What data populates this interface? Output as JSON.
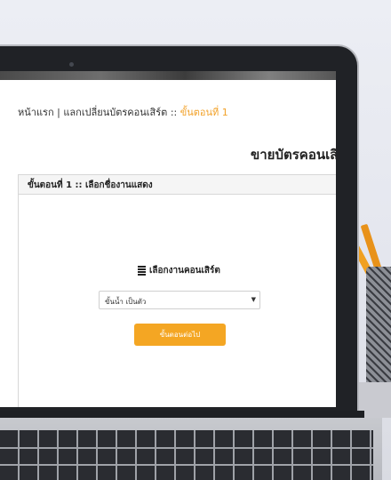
{
  "breadcrumb": {
    "home": "หน้าแรก",
    "separator": "|",
    "section": "แลกเปลี่ยนบัตรคอนเสิร์ต",
    "arrow": "::",
    "current": "ขั้นตอนที่ 1"
  },
  "page_title": "ขายบัตรคอนเสิ",
  "panel": {
    "header": "ขั้นตอนที่ 1 :: เลือกชื่องานแสดง",
    "section_label": "เลือกงานคอนเสิร์ต",
    "select_value": "ขั้นน้ำ เป็นตัว",
    "next_button": "ขั้นตอนต่อไป"
  },
  "colors": {
    "accent": "#f4a623",
    "breadcrumb_current": "#f2a22a"
  },
  "icons": {
    "list": "list-icon",
    "caret": "caret-down-icon"
  }
}
